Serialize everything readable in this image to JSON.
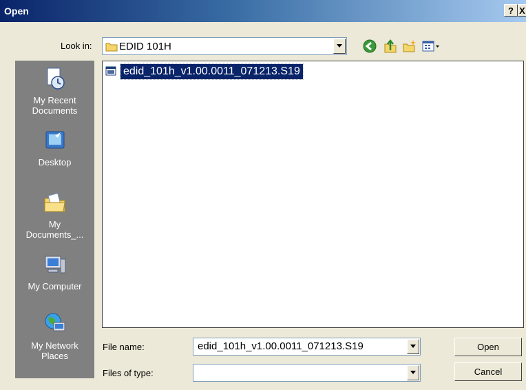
{
  "window": {
    "title": "Open",
    "help_label": "?",
    "close_label": "X"
  },
  "look_in": {
    "label": "Look in:",
    "value": "EDID 101H"
  },
  "toolbar": {
    "icons": [
      "back-icon",
      "up-folder-icon",
      "new-folder-icon",
      "views-icon"
    ]
  },
  "places": {
    "items": [
      {
        "label": "My Recent\nDocuments",
        "icon": "recent-documents-icon"
      },
      {
        "label": "Desktop",
        "icon": "desktop-icon"
      },
      {
        "label": "My\nDocuments_...",
        "icon": "my-documents-icon"
      },
      {
        "label": "My Computer",
        "icon": "my-computer-icon"
      },
      {
        "label": "My Network\nPlaces",
        "icon": "network-places-icon"
      }
    ]
  },
  "files": [
    {
      "name": "edid_101h_v1.00.0011_071213.S19",
      "selected": true
    }
  ],
  "file_name": {
    "label": "File name:",
    "value": "edid_101h_v1.00.0011_071213.S19"
  },
  "file_type": {
    "label": "Files of type:",
    "value": ""
  },
  "buttons": {
    "open": "Open",
    "cancel": "Cancel"
  },
  "colors": {
    "selection": "#0a246a",
    "places_bg": "#808080",
    "dialog_bg": "#ece9d8"
  }
}
